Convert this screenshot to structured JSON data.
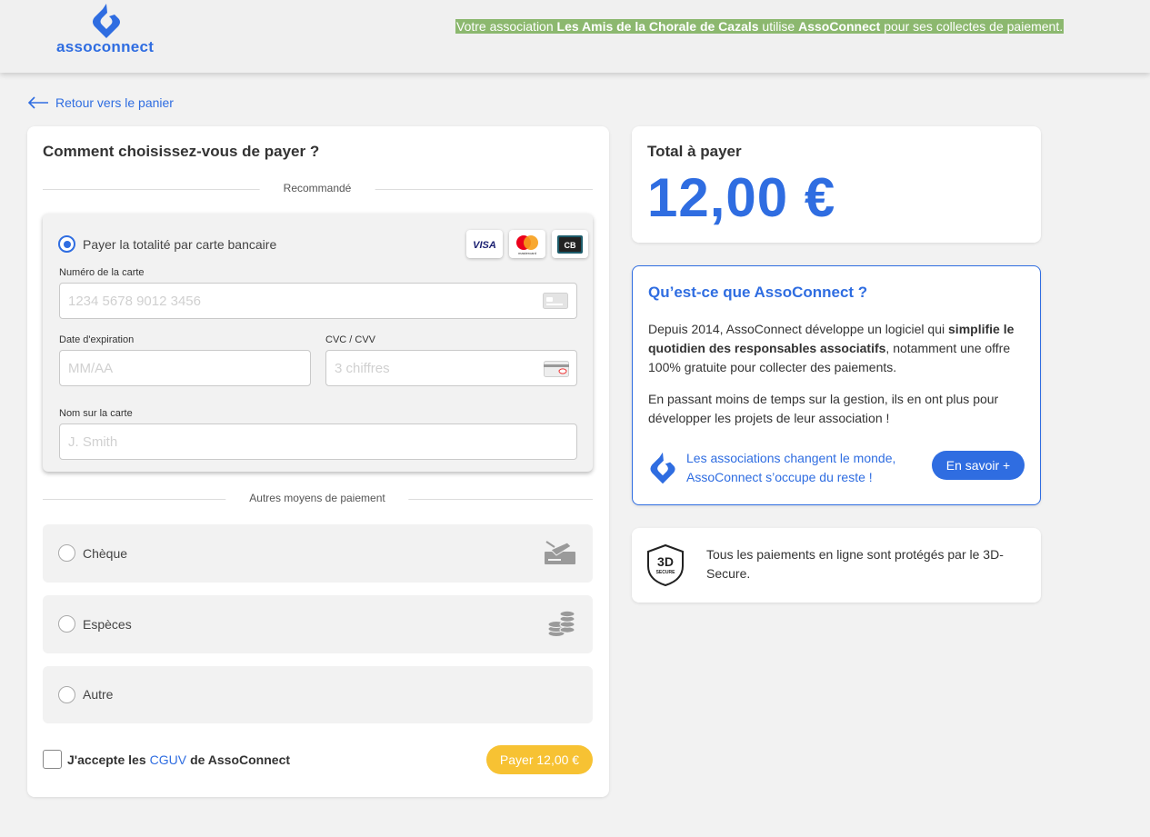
{
  "header": {
    "logo_text": "assoconnect",
    "banner": {
      "prefix": "Votre association ",
      "association": "Les Amis de la Chorale de Cazals",
      "middle": " utilise ",
      "platform": "AssoConnect",
      "suffix": " pour ses collectes de paiement."
    }
  },
  "back_link": "Retour vers le panier",
  "payment": {
    "title": "Comment choisissez-vous de payer ?",
    "recommended_label": "Recommandé",
    "card_option": {
      "label": "Payer la totalité par carte bancaire",
      "selected": true,
      "brands": [
        "VISA",
        "mastercard",
        "CB"
      ],
      "card_number_label": "Numéro de la carte",
      "card_number_placeholder": "1234 5678 9012 3456",
      "expiry_label": "Date d'expiration",
      "expiry_placeholder": "MM/AA",
      "cvc_label": "CVC / CVV",
      "cvc_placeholder": "3 chiffres",
      "name_label": "Nom sur la carte",
      "name_placeholder": "J. Smith"
    },
    "other_label": "Autres moyens de paiement",
    "other_options": [
      {
        "label": "Chèque",
        "icon": "cheque-icon"
      },
      {
        "label": "Espèces",
        "icon": "coins-icon"
      },
      {
        "label": "Autre",
        "icon": ""
      }
    ],
    "terms": {
      "prefix": "J'accepte les",
      "link": "CGUV",
      "suffix": "de AssoConnect",
      "checked": false
    },
    "pay_button": "Payer 12,00 €"
  },
  "total": {
    "label": "Total à payer",
    "amount": "12,00 €"
  },
  "info": {
    "title": "Qu’est-ce que AssoConnect ?",
    "p1_a": "Depuis 2014, AssoConnect développe un logiciel qui ",
    "p1_b": "simplifie le quotidien des responsables associatifs",
    "p1_c": ", notamment une offre 100% gratuite pour collecter des paiements.",
    "p2": "En passant moins de temps sur la gestion, ils en ont plus pour développer les projets de leur association !",
    "footer_text": "Les associations changent le monde, AssoConnect s’occupe du reste !",
    "button": "En savoir +"
  },
  "secure": {
    "badge_top": "3D",
    "badge_bottom": "SECURE",
    "text": "Tous les paiements en ligne sont protégés par le 3D-Secure."
  },
  "colors": {
    "brand_blue": "#2f6de1",
    "banner_green": "#8cb86f",
    "pay_yellow": "#f7c233",
    "background": "#f2f2f2"
  }
}
